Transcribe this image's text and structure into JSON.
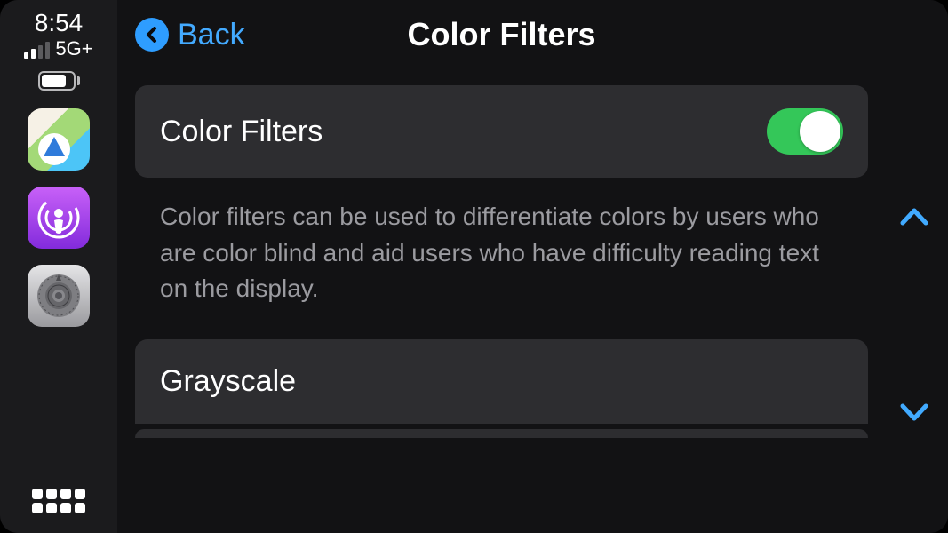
{
  "status": {
    "time": "8:54",
    "network_label": "5G+",
    "signal_bars_total": 4,
    "signal_bars_active": 2
  },
  "sidebar": {
    "apps": [
      {
        "name": "maps-icon"
      },
      {
        "name": "podcasts-icon"
      },
      {
        "name": "settings-icon"
      }
    ]
  },
  "header": {
    "back_label": "Back",
    "title": "Color Filters"
  },
  "rows": {
    "color_filters": {
      "label": "Color Filters",
      "enabled": true
    },
    "description": "Color filters can be used to differentiate colors by users who are color blind and aid users who have difficulty reading text on the display.",
    "grayscale": {
      "label": "Grayscale"
    }
  },
  "colors": {
    "accent": "#2e9dff",
    "toggle_on": "#34c759",
    "row_bg": "#2d2d30",
    "bg": "#121214",
    "sidebar_bg": "#1b1b1d",
    "text_muted": "#9b9ba0"
  }
}
